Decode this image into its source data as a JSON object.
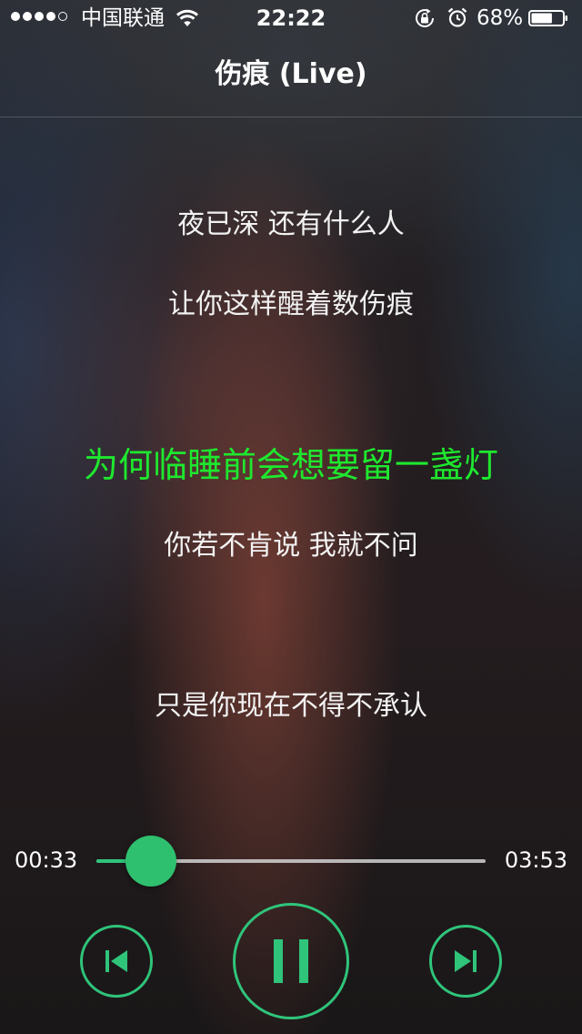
{
  "status_bar": {
    "signal_dots_filled": 4,
    "signal_dots_total": 5,
    "carrier": "中国联通",
    "time": "22:22",
    "battery_percent": "68%",
    "battery_level": 0.68,
    "icons": [
      "wifi-icon",
      "orientation-lock-icon",
      "alarm-icon",
      "battery-icon"
    ]
  },
  "header": {
    "title": "伤痕 (Live)"
  },
  "lyrics": [
    "夜已深 还有什么人",
    "让你这样醒着数伤痕",
    "为何临睡前会想要留一盏灯",
    "你若不肯说 我就不问",
    "只是你现在不得不承认"
  ],
  "current_lyric_index": 2,
  "player": {
    "elapsed": "00:33",
    "total": "03:53",
    "progress_fraction": 0.14,
    "controls": {
      "previous_icon": "skip-previous-icon",
      "pause_icon": "pause-icon",
      "next_icon": "skip-next-icon"
    }
  },
  "colors": {
    "accent": "#2fc47a",
    "current_lyric": "#1ee82e",
    "text": "#ffffff"
  }
}
